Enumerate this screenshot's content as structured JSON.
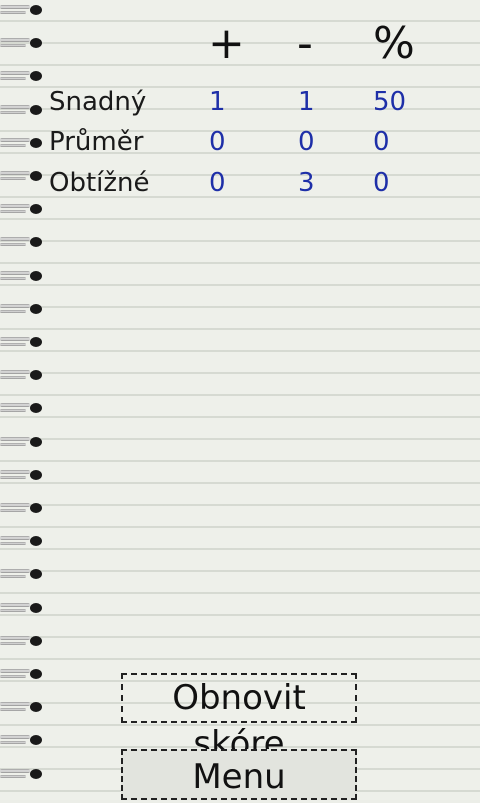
{
  "headers": {
    "plus": "+",
    "minus": "-",
    "percent": "%"
  },
  "rows": [
    {
      "label": "Snadný",
      "plus": "1",
      "minus": "1",
      "percent": "50"
    },
    {
      "label": "Průměr",
      "plus": "0",
      "minus": "0",
      "percent": "0"
    },
    {
      "label": "Obtížné",
      "plus": "0",
      "minus": "3",
      "percent": "0"
    }
  ],
  "buttons": {
    "reset": "Obnovit skóre",
    "menu": "Menu"
  },
  "colors": {
    "value_text": "#1e2fa8",
    "label_text": "#1a1a1a",
    "paper": "#eef0ea"
  },
  "icons": {
    "spiral": "spiral-binding-icon"
  }
}
